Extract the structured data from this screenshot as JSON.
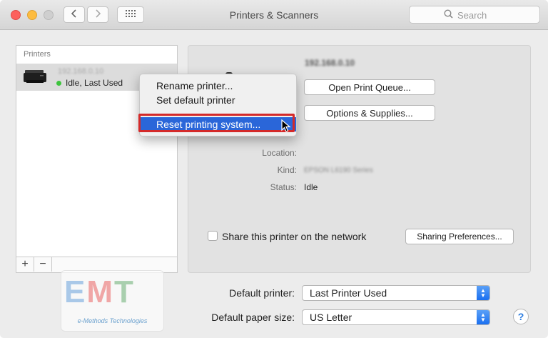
{
  "window": {
    "title": "Printers & Scanners",
    "search_placeholder": "Search"
  },
  "printers_panel": {
    "header": "Printers",
    "printer": {
      "name": "192.168.0.10",
      "status": "Idle, Last Used"
    },
    "add_symbol": "+",
    "remove_symbol": "−"
  },
  "context_menu": {
    "items": [
      {
        "label": "Rename printer..."
      },
      {
        "label": "Set default printer"
      },
      {
        "label": "Reset printing system..."
      }
    ]
  },
  "detail": {
    "printer_name": "192.168.0.10",
    "open_queue_button": "Open Print Queue...",
    "options_button": "Options & Supplies...",
    "location_label": "Location:",
    "kind_label": "Kind:",
    "kind_value": "EPSON L6190 Series",
    "status_label": "Status:",
    "status_value": "Idle",
    "share_label": "Share this printer on the network",
    "sharing_prefs_button": "Sharing Preferences..."
  },
  "bottom": {
    "default_printer_label": "Default printer:",
    "default_printer_value": "Last Printer Used",
    "default_paper_label": "Default paper size:",
    "default_paper_value": "US Letter",
    "help_symbol": "?"
  },
  "watermark": {
    "letters": [
      "E",
      "M",
      "T"
    ],
    "caption": "e-Methods Technologies"
  },
  "colors": {
    "selection": "#2a66d9",
    "highlight_border": "#d42a2a",
    "popup_accent": "#1a6ff0"
  }
}
